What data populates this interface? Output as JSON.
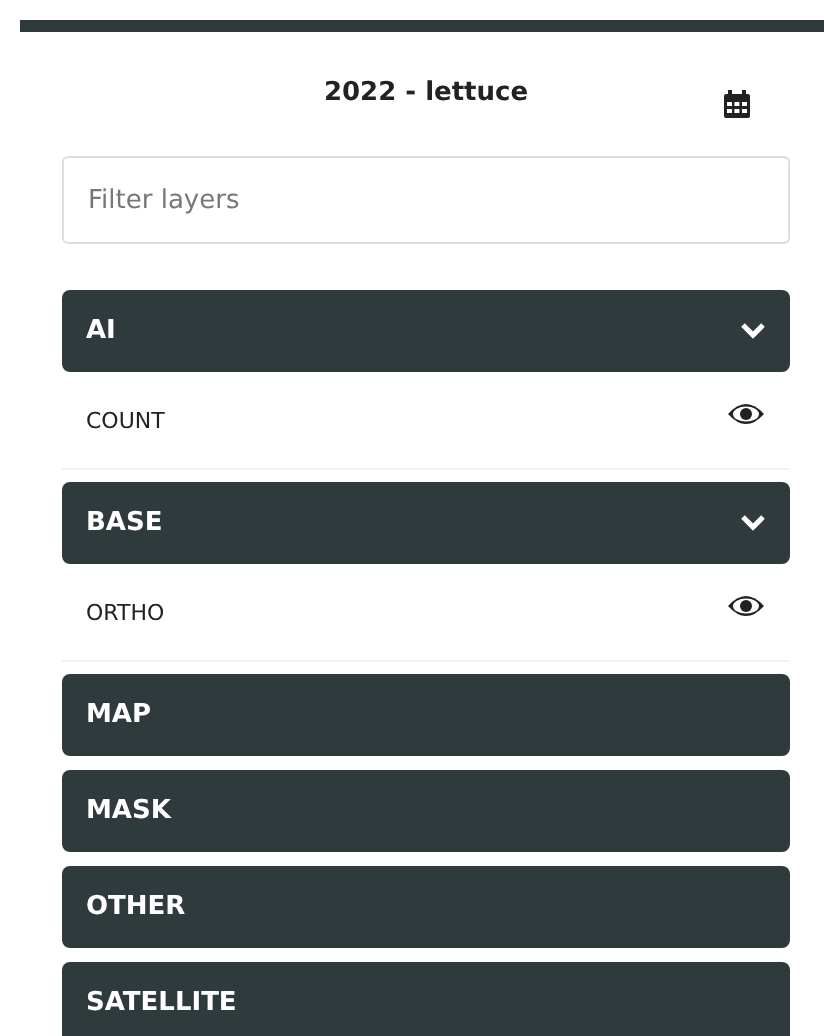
{
  "header": {
    "title": "2022 - lettuce"
  },
  "filter": {
    "placeholder": "Filter layers"
  },
  "groups": [
    {
      "name": "AI",
      "expanded": true,
      "layers": [
        {
          "name": "COUNT",
          "visible": true
        }
      ]
    },
    {
      "name": "BASE",
      "expanded": true,
      "layers": [
        {
          "name": "ORTHO",
          "visible": true
        }
      ]
    },
    {
      "name": "MAP",
      "expanded": false
    },
    {
      "name": "MASK",
      "expanded": false
    },
    {
      "name": "OTHER",
      "expanded": false
    },
    {
      "name": "SATELLITE",
      "expanded": false
    }
  ]
}
